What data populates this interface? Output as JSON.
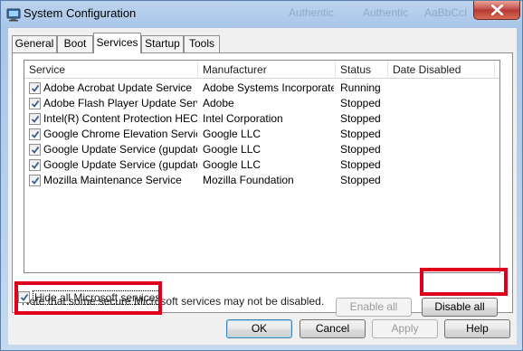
{
  "window": {
    "title": "System Configuration",
    "ghost_texts": [
      "Authentic",
      "Authentic",
      "AaBbCcI"
    ],
    "close_icon": "close-icon"
  },
  "tabs": [
    {
      "label": "General",
      "active": false
    },
    {
      "label": "Boot",
      "active": false
    },
    {
      "label": "Services",
      "active": true
    },
    {
      "label": "Startup",
      "active": false
    },
    {
      "label": "Tools",
      "active": false
    }
  ],
  "services_list": {
    "columns": [
      "Service",
      "Manufacturer",
      "Status",
      "Date Disabled"
    ],
    "rows": [
      {
        "checked": true,
        "service": "Adobe Acrobat Update Service",
        "manufacturer": "Adobe Systems Incorporated",
        "status": "Running",
        "date_disabled": ""
      },
      {
        "checked": true,
        "service": "Adobe Flash Player Update Service",
        "manufacturer": "Adobe",
        "status": "Stopped",
        "date_disabled": ""
      },
      {
        "checked": true,
        "service": "Intel(R) Content Protection HEC...",
        "manufacturer": "Intel Corporation",
        "status": "Stopped",
        "date_disabled": ""
      },
      {
        "checked": true,
        "service": "Google Chrome Elevation Servic...",
        "manufacturer": "Google LLC",
        "status": "Stopped",
        "date_disabled": ""
      },
      {
        "checked": true,
        "service": "Google Update Service (gupdate)",
        "manufacturer": "Google LLC",
        "status": "Stopped",
        "date_disabled": ""
      },
      {
        "checked": true,
        "service": "Google Update Service (gupdatem)",
        "manufacturer": "Google LLC",
        "status": "Stopped",
        "date_disabled": ""
      },
      {
        "checked": true,
        "service": "Mozilla Maintenance Service",
        "manufacturer": "Mozilla Foundation",
        "status": "Stopped",
        "date_disabled": ""
      }
    ]
  },
  "note": "Note that some secure Microsoft services may not be disabled.",
  "buttons": {
    "enable_all": "Enable all",
    "disable_all": "Disable all",
    "ok": "OK",
    "cancel": "Cancel",
    "apply": "Apply",
    "help": "Help"
  },
  "hide_microsoft": {
    "label": "Hide all Microsoft services",
    "checked": true
  },
  "colors": {
    "highlight_box": "#e0001b"
  }
}
